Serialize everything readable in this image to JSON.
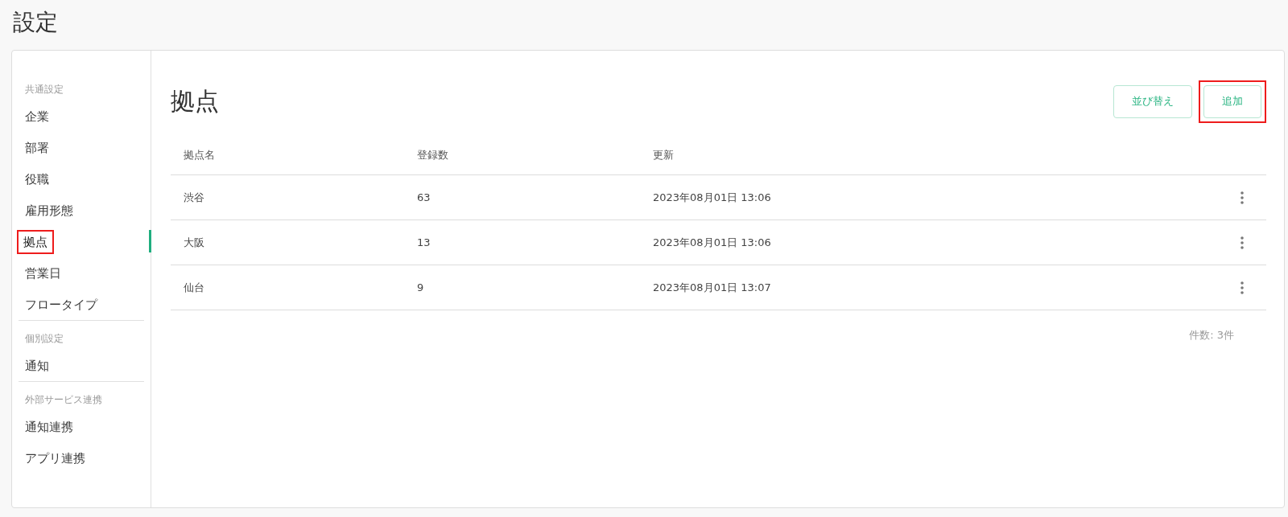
{
  "page_title": "設定",
  "sidebar": {
    "groups": [
      {
        "heading": "共通設定",
        "items": [
          {
            "label": "企業",
            "selected": false,
            "highlighted": false
          },
          {
            "label": "部署",
            "selected": false,
            "highlighted": false
          },
          {
            "label": "役職",
            "selected": false,
            "highlighted": false
          },
          {
            "label": "雇用形態",
            "selected": false,
            "highlighted": false
          },
          {
            "label": "拠点",
            "selected": true,
            "highlighted": true
          },
          {
            "label": "営業日",
            "selected": false,
            "highlighted": false
          },
          {
            "label": "フロータイプ",
            "selected": false,
            "highlighted": false
          }
        ]
      },
      {
        "heading": "個別設定",
        "items": [
          {
            "label": "通知",
            "selected": false,
            "highlighted": false
          }
        ]
      },
      {
        "heading": "外部サービス連携",
        "items": [
          {
            "label": "通知連携",
            "selected": false,
            "highlighted": false
          },
          {
            "label": "アプリ連携",
            "selected": false,
            "highlighted": false
          }
        ]
      }
    ]
  },
  "main": {
    "title": "拠点",
    "buttons": [
      {
        "label": "並び替え",
        "highlighted": false
      },
      {
        "label": "追加",
        "highlighted": true
      }
    ],
    "table": {
      "columns": [
        "拠点名",
        "登録数",
        "更新"
      ],
      "rows": [
        {
          "name": "渋谷",
          "count": "63",
          "updated": "2023年08月01日 13:06"
        },
        {
          "name": "大阪",
          "count": "13",
          "updated": "2023年08月01日 13:06"
        },
        {
          "name": "仙台",
          "count": "9",
          "updated": "2023年08月01日 13:07"
        }
      ]
    },
    "total": "件数: 3件"
  }
}
